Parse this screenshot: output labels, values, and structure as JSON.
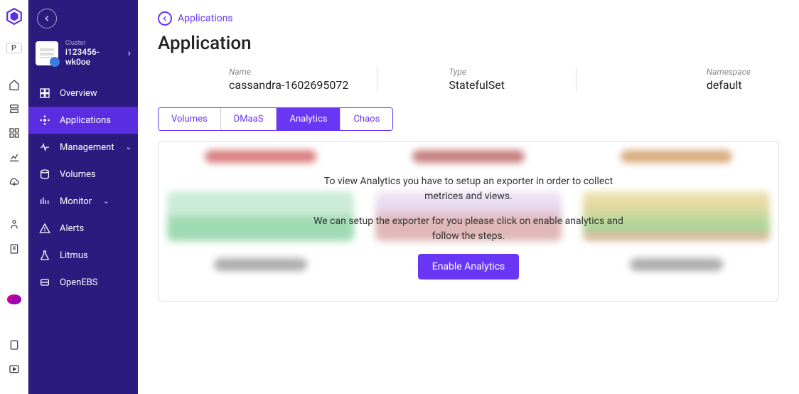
{
  "rail_p": "P",
  "sidebar": {
    "cluster_label": "Cluster",
    "cluster_name": "i123456-wk0oe",
    "items": [
      {
        "label": "Overview"
      },
      {
        "label": "Applications"
      },
      {
        "label": "Management"
      },
      {
        "label": "Volumes"
      },
      {
        "label": "Monitor"
      },
      {
        "label": "Alerts"
      },
      {
        "label": "Litmus"
      },
      {
        "label": "OpenEBS"
      }
    ]
  },
  "breadcrumb": "Applications",
  "page_title": "Application",
  "meta": {
    "name_label": "Name",
    "name_value": "cassandra-1602695072",
    "type_label": "Type",
    "type_value": "StatefulSet",
    "ns_label": "Namespace",
    "ns_value": "default"
  },
  "tabs": {
    "volumes": "Volumes",
    "dmaas": "DMaaS",
    "analytics": "Analytics",
    "chaos": "Chaos"
  },
  "analytics_panel": {
    "msg1": "To view Analytics you have to setup an exporter in order to collect metrices and views.",
    "msg2": "We can setup the exporter for you please click on enable analytics and follow the steps.",
    "button": "Enable Analytics"
  }
}
